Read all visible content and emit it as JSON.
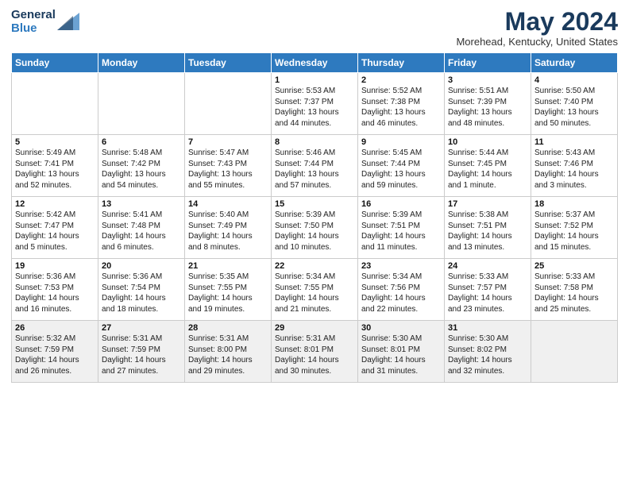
{
  "header": {
    "logo_line1": "General",
    "logo_line2": "Blue",
    "month": "May 2024",
    "location": "Morehead, Kentucky, United States"
  },
  "days_of_week": [
    "Sunday",
    "Monday",
    "Tuesday",
    "Wednesday",
    "Thursday",
    "Friday",
    "Saturday"
  ],
  "weeks": [
    [
      {
        "day": "",
        "info": ""
      },
      {
        "day": "",
        "info": ""
      },
      {
        "day": "",
        "info": ""
      },
      {
        "day": "1",
        "info": "Sunrise: 5:53 AM\nSunset: 7:37 PM\nDaylight: 13 hours\nand 44 minutes."
      },
      {
        "day": "2",
        "info": "Sunrise: 5:52 AM\nSunset: 7:38 PM\nDaylight: 13 hours\nand 46 minutes."
      },
      {
        "day": "3",
        "info": "Sunrise: 5:51 AM\nSunset: 7:39 PM\nDaylight: 13 hours\nand 48 minutes."
      },
      {
        "day": "4",
        "info": "Sunrise: 5:50 AM\nSunset: 7:40 PM\nDaylight: 13 hours\nand 50 minutes."
      }
    ],
    [
      {
        "day": "5",
        "info": "Sunrise: 5:49 AM\nSunset: 7:41 PM\nDaylight: 13 hours\nand 52 minutes."
      },
      {
        "day": "6",
        "info": "Sunrise: 5:48 AM\nSunset: 7:42 PM\nDaylight: 13 hours\nand 54 minutes."
      },
      {
        "day": "7",
        "info": "Sunrise: 5:47 AM\nSunset: 7:43 PM\nDaylight: 13 hours\nand 55 minutes."
      },
      {
        "day": "8",
        "info": "Sunrise: 5:46 AM\nSunset: 7:44 PM\nDaylight: 13 hours\nand 57 minutes."
      },
      {
        "day": "9",
        "info": "Sunrise: 5:45 AM\nSunset: 7:44 PM\nDaylight: 13 hours\nand 59 minutes."
      },
      {
        "day": "10",
        "info": "Sunrise: 5:44 AM\nSunset: 7:45 PM\nDaylight: 14 hours\nand 1 minute."
      },
      {
        "day": "11",
        "info": "Sunrise: 5:43 AM\nSunset: 7:46 PM\nDaylight: 14 hours\nand 3 minutes."
      }
    ],
    [
      {
        "day": "12",
        "info": "Sunrise: 5:42 AM\nSunset: 7:47 PM\nDaylight: 14 hours\nand 5 minutes."
      },
      {
        "day": "13",
        "info": "Sunrise: 5:41 AM\nSunset: 7:48 PM\nDaylight: 14 hours\nand 6 minutes."
      },
      {
        "day": "14",
        "info": "Sunrise: 5:40 AM\nSunset: 7:49 PM\nDaylight: 14 hours\nand 8 minutes."
      },
      {
        "day": "15",
        "info": "Sunrise: 5:39 AM\nSunset: 7:50 PM\nDaylight: 14 hours\nand 10 minutes."
      },
      {
        "day": "16",
        "info": "Sunrise: 5:39 AM\nSunset: 7:51 PM\nDaylight: 14 hours\nand 11 minutes."
      },
      {
        "day": "17",
        "info": "Sunrise: 5:38 AM\nSunset: 7:51 PM\nDaylight: 14 hours\nand 13 minutes."
      },
      {
        "day": "18",
        "info": "Sunrise: 5:37 AM\nSunset: 7:52 PM\nDaylight: 14 hours\nand 15 minutes."
      }
    ],
    [
      {
        "day": "19",
        "info": "Sunrise: 5:36 AM\nSunset: 7:53 PM\nDaylight: 14 hours\nand 16 minutes."
      },
      {
        "day": "20",
        "info": "Sunrise: 5:36 AM\nSunset: 7:54 PM\nDaylight: 14 hours\nand 18 minutes."
      },
      {
        "day": "21",
        "info": "Sunrise: 5:35 AM\nSunset: 7:55 PM\nDaylight: 14 hours\nand 19 minutes."
      },
      {
        "day": "22",
        "info": "Sunrise: 5:34 AM\nSunset: 7:55 PM\nDaylight: 14 hours\nand 21 minutes."
      },
      {
        "day": "23",
        "info": "Sunrise: 5:34 AM\nSunset: 7:56 PM\nDaylight: 14 hours\nand 22 minutes."
      },
      {
        "day": "24",
        "info": "Sunrise: 5:33 AM\nSunset: 7:57 PM\nDaylight: 14 hours\nand 23 minutes."
      },
      {
        "day": "25",
        "info": "Sunrise: 5:33 AM\nSunset: 7:58 PM\nDaylight: 14 hours\nand 25 minutes."
      }
    ],
    [
      {
        "day": "26",
        "info": "Sunrise: 5:32 AM\nSunset: 7:59 PM\nDaylight: 14 hours\nand 26 minutes."
      },
      {
        "day": "27",
        "info": "Sunrise: 5:31 AM\nSunset: 7:59 PM\nDaylight: 14 hours\nand 27 minutes."
      },
      {
        "day": "28",
        "info": "Sunrise: 5:31 AM\nSunset: 8:00 PM\nDaylight: 14 hours\nand 29 minutes."
      },
      {
        "day": "29",
        "info": "Sunrise: 5:31 AM\nSunset: 8:01 PM\nDaylight: 14 hours\nand 30 minutes."
      },
      {
        "day": "30",
        "info": "Sunrise: 5:30 AM\nSunset: 8:01 PM\nDaylight: 14 hours\nand 31 minutes."
      },
      {
        "day": "31",
        "info": "Sunrise: 5:30 AM\nSunset: 8:02 PM\nDaylight: 14 hours\nand 32 minutes."
      },
      {
        "day": "",
        "info": ""
      }
    ]
  ]
}
